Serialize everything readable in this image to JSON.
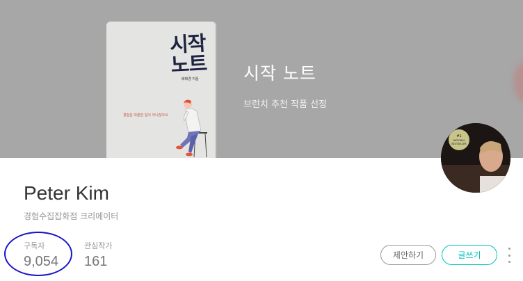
{
  "cover": {
    "book": {
      "title": "시작 노트",
      "author": "배태경 지음",
      "subtitle": "경험은 따분한 일이 아니잖아요"
    },
    "title": "시작 노트",
    "subtitle": "브런치 추천 작품 선정"
  },
  "profile": {
    "name": "Peter Kim",
    "description": "경험수집잡화점 크리에이터",
    "avatar_badge": [
      "#1",
      "NATIONAL",
      "BESTSELLER"
    ],
    "stats": [
      {
        "label": "구독자",
        "value": "9,054"
      },
      {
        "label": "관심작가",
        "value": "161"
      }
    ]
  },
  "actions": {
    "suggest_label": "제안하기",
    "write_label": "글쓰기",
    "more_icon": "more-vertical-icon"
  },
  "colors": {
    "cover_bg": "#a7a7a7",
    "accent": "#00c3bd",
    "annotation": "#1a14c8"
  }
}
